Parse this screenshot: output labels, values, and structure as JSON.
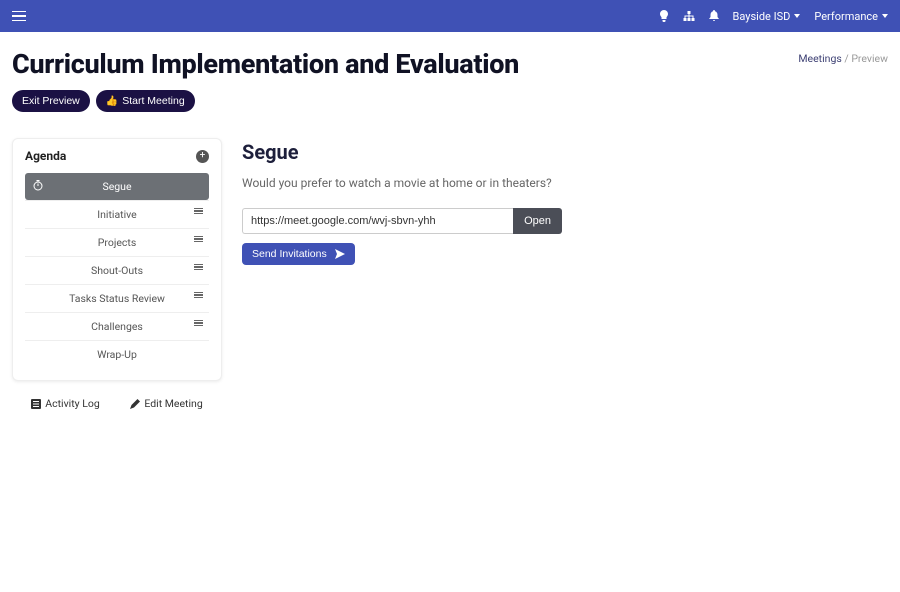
{
  "top": {
    "org": "Bayside ISD",
    "nav": "Performance"
  },
  "title": "Curriculum Implementation and Evaluation",
  "breadcrumb": {
    "root": "Meetings",
    "current": "Preview"
  },
  "buttons": {
    "exit_preview": "Exit Preview",
    "start_meeting": "Start Meeting",
    "open": "Open",
    "send_invitations": "Send Invitations"
  },
  "sidebar": {
    "title": "Agenda",
    "items": [
      "Segue",
      "Initiative",
      "Projects",
      "Shout-Outs",
      "Tasks Status Review",
      "Challenges",
      "Wrap-Up"
    ],
    "footer": {
      "activity_log": "Activity Log",
      "edit_meeting": "Edit Meeting"
    }
  },
  "main": {
    "heading": "Segue",
    "question": "Would you prefer to watch a movie at home or in theaters?",
    "meeting_url": "https://meet.google.com/wvj-sbvn-yhh"
  }
}
